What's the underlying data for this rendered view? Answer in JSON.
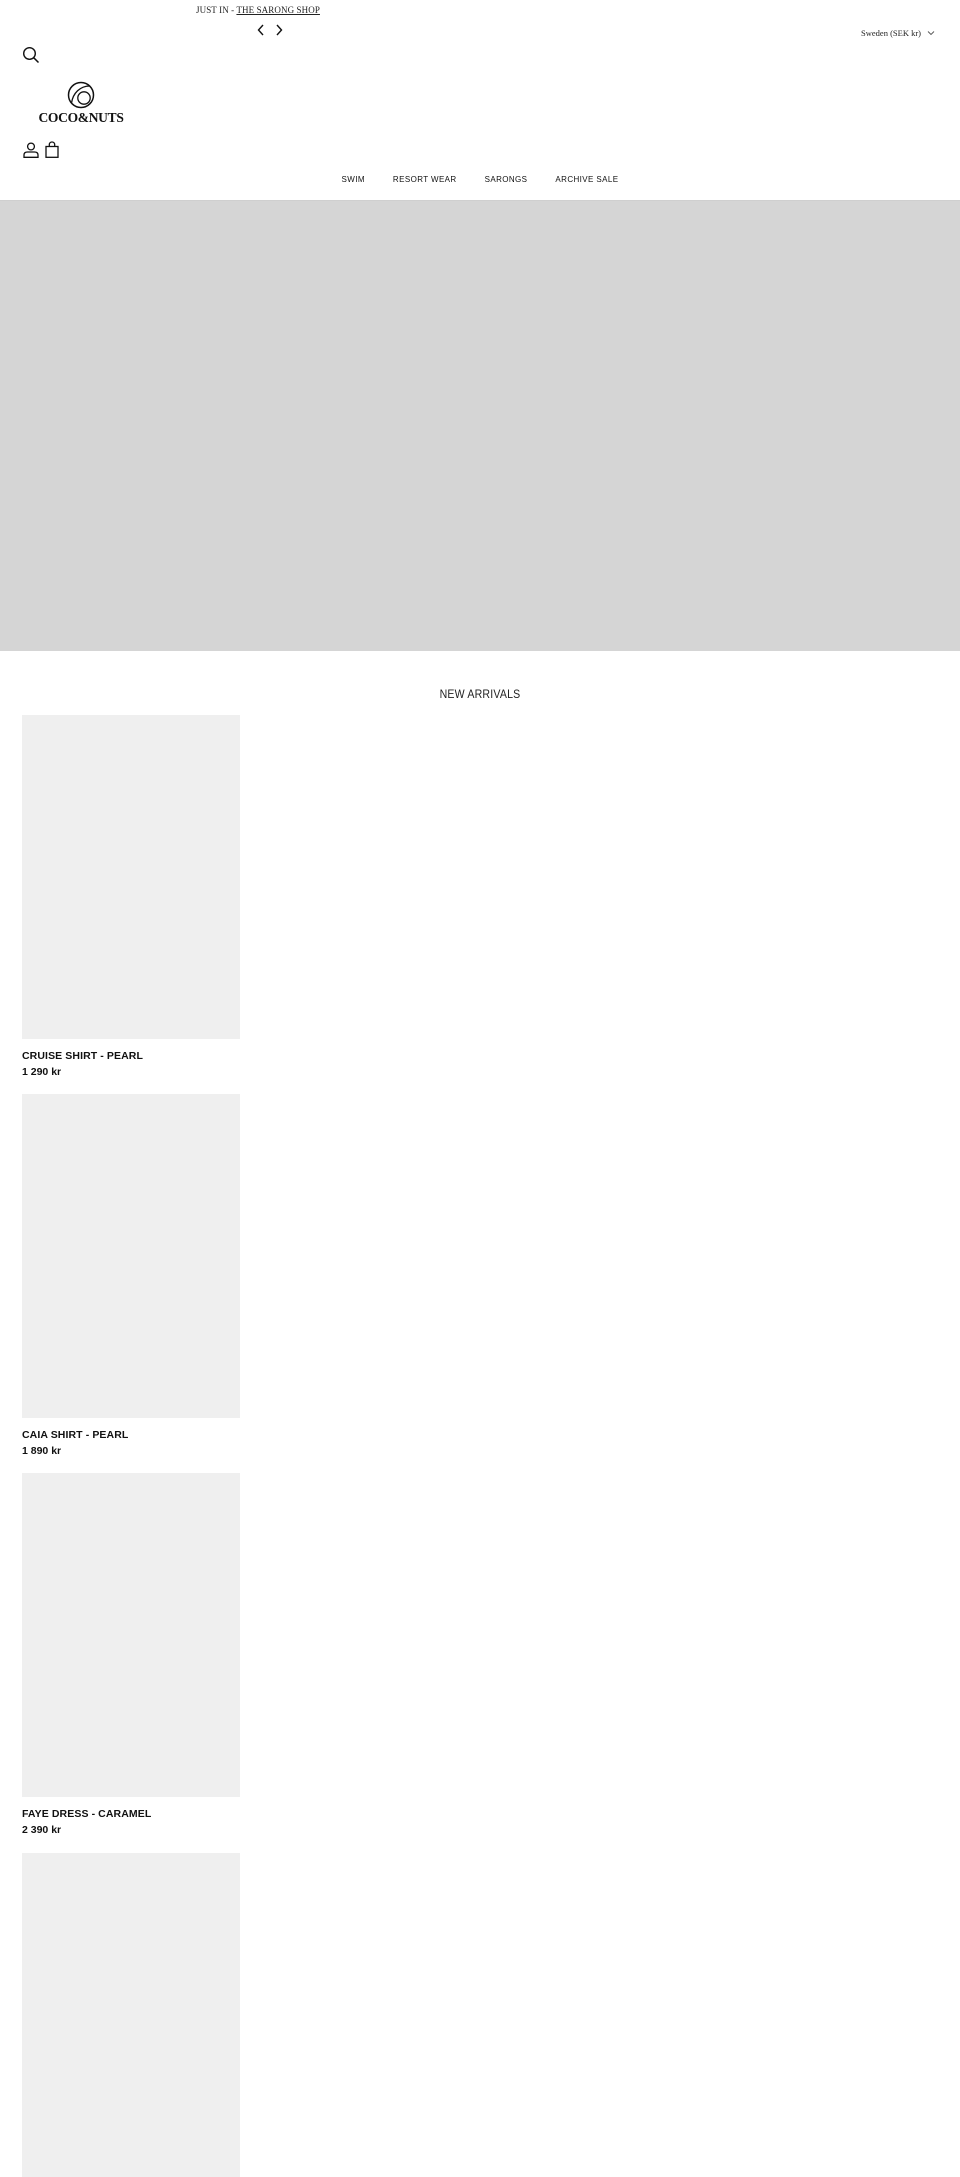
{
  "announcement": {
    "prefix": "JUST IN - ",
    "link_label": "THE SARONG SHOP",
    "prev_icon": "chevron-left-icon",
    "next_icon": "chevron-right-icon"
  },
  "locale": {
    "label": "Sweden (SEK kr)",
    "icon": "chevron-down-icon"
  },
  "header": {
    "search_icon": "search-icon",
    "logo_text": "COCO&NUTS",
    "account_icon": "user-icon",
    "cart_icon": "shopping-bag-icon"
  },
  "nav": {
    "items": [
      {
        "label": "SWIM"
      },
      {
        "label": "RESORT WEAR"
      },
      {
        "label": "SARONGS"
      },
      {
        "label": "ARCHIVE SALE"
      }
    ]
  },
  "colors": {
    "hero_placeholder": "#d5d5d5",
    "product_placeholder": "#efefef",
    "text": "#111111"
  },
  "new_arrivals": {
    "title": "NEW ARRIVALS",
    "products": [
      {
        "name": "CRUISE SHIRT - PEARL",
        "price": "1 290 kr"
      },
      {
        "name": "CAIA SHIRT - PEARL",
        "price": "1 890 kr"
      },
      {
        "name": "FAYE DRESS - CARAMEL",
        "price": "2 390 kr"
      }
    ]
  }
}
